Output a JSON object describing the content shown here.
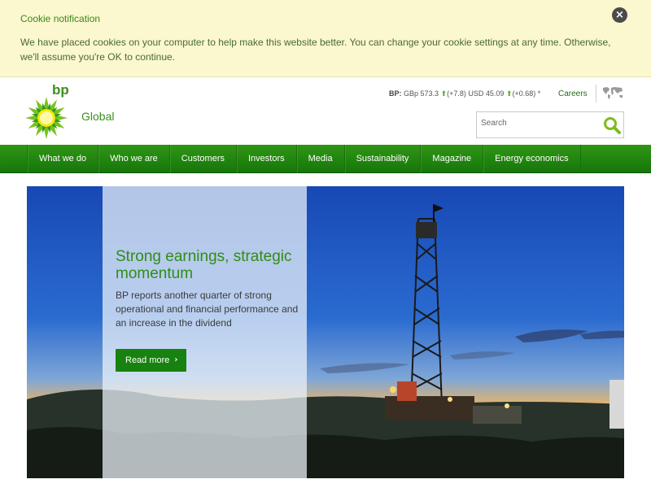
{
  "cookie": {
    "title": "Cookie notification",
    "text": "We have placed cookies on your computer to help make this website better. You can change your cookie settings at any time. Otherwise, we'll assume you're OK to continue.",
    "close_icon": "close-icon"
  },
  "header": {
    "logo_text": "bp",
    "site_name": "Global",
    "ticker": {
      "label": "BP:",
      "gbp": "GBp 573.3",
      "gbp_change": "(+7.8)",
      "usd": "USD 45.09",
      "usd_change": "(+0.68)",
      "footnote": "*"
    },
    "careers": "Careers",
    "search_placeholder": "Search"
  },
  "nav": {
    "items": [
      {
        "label": "What we do"
      },
      {
        "label": "Who we are"
      },
      {
        "label": "Customers"
      },
      {
        "label": "Investors"
      },
      {
        "label": "Media"
      },
      {
        "label": "Sustainability"
      },
      {
        "label": "Magazine"
      },
      {
        "label": "Energy economics"
      }
    ]
  },
  "hero": {
    "title": "Strong earnings, strategic momentum",
    "text": "BP reports another quarter of strong operational and financial performance and an increase in the dividend",
    "button": "Read more"
  },
  "colors": {
    "brand_green": "#2f8d14",
    "nav_green": "#1e7f0e",
    "cookie_bg": "#fbf7cf"
  }
}
